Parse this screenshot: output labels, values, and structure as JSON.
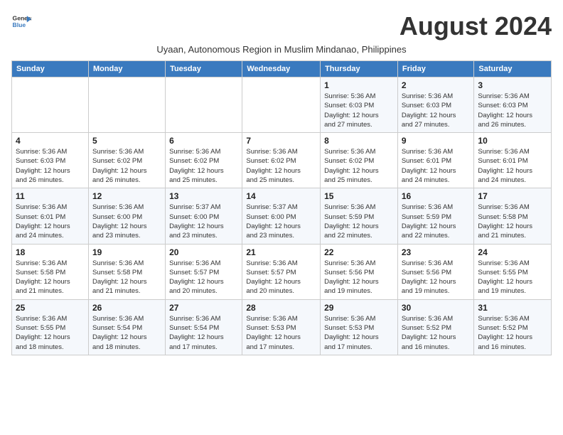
{
  "header": {
    "logo_line1": "General",
    "logo_line2": "Blue",
    "month_title": "August 2024",
    "subtitle": "Uyaan, Autonomous Region in Muslim Mindanao, Philippines"
  },
  "columns": [
    "Sunday",
    "Monday",
    "Tuesday",
    "Wednesday",
    "Thursday",
    "Friday",
    "Saturday"
  ],
  "weeks": [
    [
      {
        "day": "",
        "info": ""
      },
      {
        "day": "",
        "info": ""
      },
      {
        "day": "",
        "info": ""
      },
      {
        "day": "",
        "info": ""
      },
      {
        "day": "1",
        "info": "Sunrise: 5:36 AM\nSunset: 6:03 PM\nDaylight: 12 hours\nand 27 minutes."
      },
      {
        "day": "2",
        "info": "Sunrise: 5:36 AM\nSunset: 6:03 PM\nDaylight: 12 hours\nand 27 minutes."
      },
      {
        "day": "3",
        "info": "Sunrise: 5:36 AM\nSunset: 6:03 PM\nDaylight: 12 hours\nand 26 minutes."
      }
    ],
    [
      {
        "day": "4",
        "info": "Sunrise: 5:36 AM\nSunset: 6:03 PM\nDaylight: 12 hours\nand 26 minutes."
      },
      {
        "day": "5",
        "info": "Sunrise: 5:36 AM\nSunset: 6:02 PM\nDaylight: 12 hours\nand 26 minutes."
      },
      {
        "day": "6",
        "info": "Sunrise: 5:36 AM\nSunset: 6:02 PM\nDaylight: 12 hours\nand 25 minutes."
      },
      {
        "day": "7",
        "info": "Sunrise: 5:36 AM\nSunset: 6:02 PM\nDaylight: 12 hours\nand 25 minutes."
      },
      {
        "day": "8",
        "info": "Sunrise: 5:36 AM\nSunset: 6:02 PM\nDaylight: 12 hours\nand 25 minutes."
      },
      {
        "day": "9",
        "info": "Sunrise: 5:36 AM\nSunset: 6:01 PM\nDaylight: 12 hours\nand 24 minutes."
      },
      {
        "day": "10",
        "info": "Sunrise: 5:36 AM\nSunset: 6:01 PM\nDaylight: 12 hours\nand 24 minutes."
      }
    ],
    [
      {
        "day": "11",
        "info": "Sunrise: 5:36 AM\nSunset: 6:01 PM\nDaylight: 12 hours\nand 24 minutes."
      },
      {
        "day": "12",
        "info": "Sunrise: 5:36 AM\nSunset: 6:00 PM\nDaylight: 12 hours\nand 23 minutes."
      },
      {
        "day": "13",
        "info": "Sunrise: 5:37 AM\nSunset: 6:00 PM\nDaylight: 12 hours\nand 23 minutes."
      },
      {
        "day": "14",
        "info": "Sunrise: 5:37 AM\nSunset: 6:00 PM\nDaylight: 12 hours\nand 23 minutes."
      },
      {
        "day": "15",
        "info": "Sunrise: 5:36 AM\nSunset: 5:59 PM\nDaylight: 12 hours\nand 22 minutes."
      },
      {
        "day": "16",
        "info": "Sunrise: 5:36 AM\nSunset: 5:59 PM\nDaylight: 12 hours\nand 22 minutes."
      },
      {
        "day": "17",
        "info": "Sunrise: 5:36 AM\nSunset: 5:58 PM\nDaylight: 12 hours\nand 21 minutes."
      }
    ],
    [
      {
        "day": "18",
        "info": "Sunrise: 5:36 AM\nSunset: 5:58 PM\nDaylight: 12 hours\nand 21 minutes."
      },
      {
        "day": "19",
        "info": "Sunrise: 5:36 AM\nSunset: 5:58 PM\nDaylight: 12 hours\nand 21 minutes."
      },
      {
        "day": "20",
        "info": "Sunrise: 5:36 AM\nSunset: 5:57 PM\nDaylight: 12 hours\nand 20 minutes."
      },
      {
        "day": "21",
        "info": "Sunrise: 5:36 AM\nSunset: 5:57 PM\nDaylight: 12 hours\nand 20 minutes."
      },
      {
        "day": "22",
        "info": "Sunrise: 5:36 AM\nSunset: 5:56 PM\nDaylight: 12 hours\nand 19 minutes."
      },
      {
        "day": "23",
        "info": "Sunrise: 5:36 AM\nSunset: 5:56 PM\nDaylight: 12 hours\nand 19 minutes."
      },
      {
        "day": "24",
        "info": "Sunrise: 5:36 AM\nSunset: 5:55 PM\nDaylight: 12 hours\nand 19 minutes."
      }
    ],
    [
      {
        "day": "25",
        "info": "Sunrise: 5:36 AM\nSunset: 5:55 PM\nDaylight: 12 hours\nand 18 minutes."
      },
      {
        "day": "26",
        "info": "Sunrise: 5:36 AM\nSunset: 5:54 PM\nDaylight: 12 hours\nand 18 minutes."
      },
      {
        "day": "27",
        "info": "Sunrise: 5:36 AM\nSunset: 5:54 PM\nDaylight: 12 hours\nand 17 minutes."
      },
      {
        "day": "28",
        "info": "Sunrise: 5:36 AM\nSunset: 5:53 PM\nDaylight: 12 hours\nand 17 minutes."
      },
      {
        "day": "29",
        "info": "Sunrise: 5:36 AM\nSunset: 5:53 PM\nDaylight: 12 hours\nand 17 minutes."
      },
      {
        "day": "30",
        "info": "Sunrise: 5:36 AM\nSunset: 5:52 PM\nDaylight: 12 hours\nand 16 minutes."
      },
      {
        "day": "31",
        "info": "Sunrise: 5:36 AM\nSunset: 5:52 PM\nDaylight: 12 hours\nand 16 minutes."
      }
    ]
  ]
}
